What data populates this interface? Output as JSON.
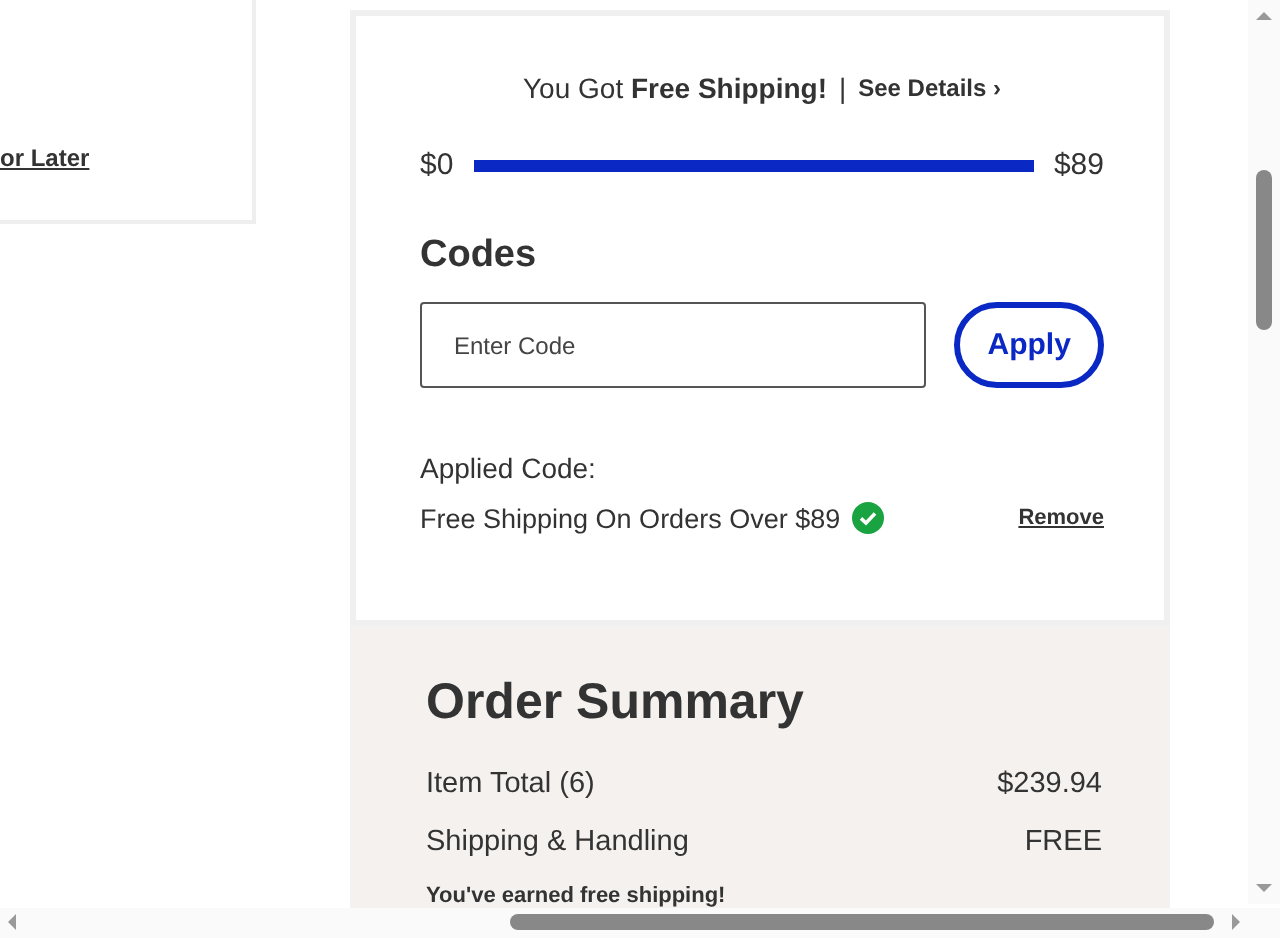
{
  "left_card": {
    "link": "or Later"
  },
  "shipping_banner": {
    "prefix": "You Got ",
    "highlight": "Free Shipping!",
    "separator": "|",
    "link": "See Details",
    "link_icon": "›"
  },
  "progress": {
    "start": "$0",
    "end": "$89",
    "level": 1
  },
  "codes": {
    "title": "Codes",
    "placeholder": "Enter Code",
    "button": "Apply",
    "applied_label": "Applied Code:",
    "applied_code": "Free Shipping On Orders Over $89",
    "remove": "Remove"
  },
  "order_summary": {
    "title": "Order Summary",
    "rows": [
      {
        "label": "Item Total (6)",
        "value": "$239.94"
      },
      {
        "label": "Shipping & Handling",
        "value": "FREE"
      }
    ],
    "note": "You've earned free shipping!"
  }
}
